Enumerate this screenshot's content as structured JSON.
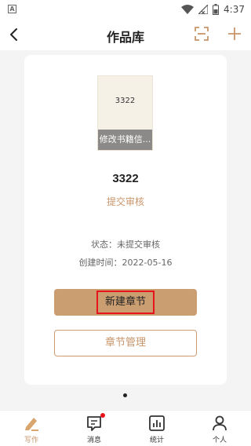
{
  "status_bar": {
    "app_icon_letter": "A",
    "time": "4:37"
  },
  "header": {
    "title": "作品库"
  },
  "book": {
    "cover_title": "3322",
    "edit_cover_label": "修改书籍信...",
    "title": "3322",
    "submit_label": "提交审核",
    "status_text": "状态：未提交审核",
    "created_text": "创建时间：2022-05-16"
  },
  "actions": {
    "new_chapter": "新建章节",
    "manage_chapters": "章节管理"
  },
  "tabs": [
    {
      "label": "写作",
      "active": true,
      "icon": "pen-icon"
    },
    {
      "label": "消息",
      "badge": true,
      "icon": "message-icon"
    },
    {
      "label": "统计",
      "icon": "chart-icon"
    },
    {
      "label": "个人",
      "icon": "person-icon"
    }
  ],
  "colors": {
    "accent": "#c8956a",
    "button_fill": "#cb9e72",
    "highlight": "#e8141b"
  }
}
